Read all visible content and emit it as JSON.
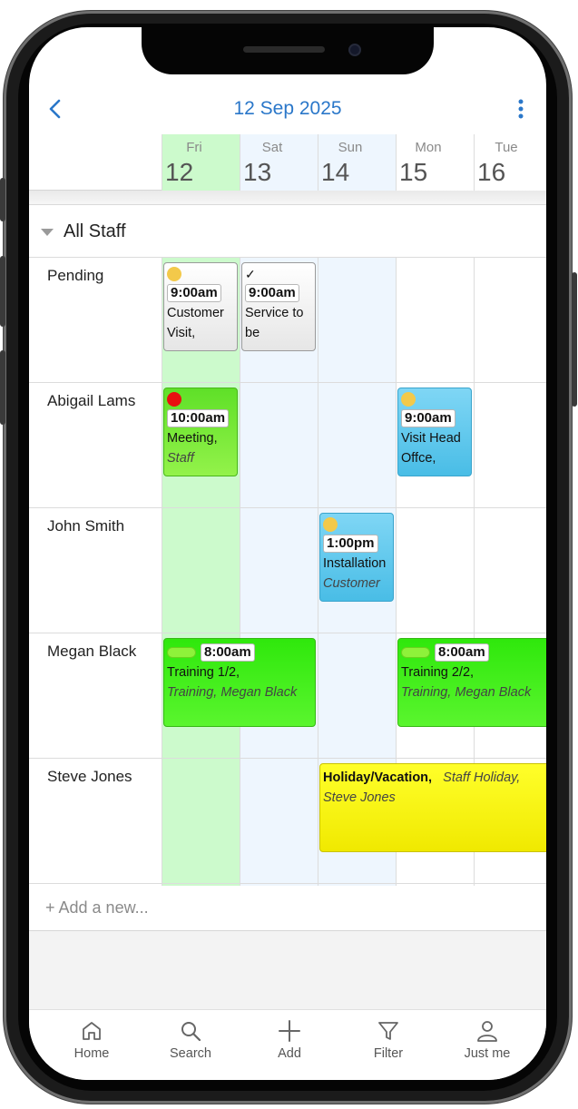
{
  "header": {
    "title": "12 Sep 2025"
  },
  "days": [
    {
      "dow": "Fri",
      "num": "12",
      "bg": "#ccfacc"
    },
    {
      "dow": "Sat",
      "num": "13",
      "bg": "#eef6fe"
    },
    {
      "dow": "Sun",
      "num": "14",
      "bg": "#eef6fe"
    },
    {
      "dow": "Mon",
      "num": "15",
      "bg": "#ffffff"
    },
    {
      "dow": "Tue",
      "num": "16",
      "bg": "#ffffff"
    }
  ],
  "group": {
    "label": "All Staff"
  },
  "rows": [
    {
      "label": "Pending"
    },
    {
      "label": "Abigail Lams"
    },
    {
      "label": "John Smith"
    },
    {
      "label": "Megan Black"
    },
    {
      "label": "Steve Jones"
    }
  ],
  "events": {
    "e1": {
      "time": "9:00am",
      "line1": "Customer",
      "line2": "Visit,",
      "status": "yellow-dot"
    },
    "e2": {
      "time": "9:00am",
      "line1": "Service to",
      "line2": "be",
      "status": "check"
    },
    "e3": {
      "time": "10:00am",
      "line1": "Meeting,",
      "sub": "Staff",
      "status": "red-dot"
    },
    "e4": {
      "time": "9:00am",
      "line1": "Visit Head",
      "line2": "Offce,",
      "status": "yellow-dot"
    },
    "e5": {
      "time": "1:00pm",
      "line1": "Installation",
      "sub": "Customer",
      "status": "yellow-dot"
    },
    "e6": {
      "time": "8:00am",
      "line1": "Training 1/2,",
      "sub": "Training, Megan Black"
    },
    "e7": {
      "time": "8:00am",
      "line1": "Training 2/2,",
      "sub": "Training, Megan Black"
    },
    "e8": {
      "title": "Holiday/Vacation,",
      "sub1": "Staff Holiday,",
      "sub2": "Steve Jones"
    }
  },
  "add_new": {
    "label": "+ Add a new..."
  },
  "tabs": [
    {
      "label": "Home",
      "icon": "home-icon"
    },
    {
      "label": "Search",
      "icon": "search-icon"
    },
    {
      "label": "Add",
      "icon": "plus-icon"
    },
    {
      "label": "Filter",
      "icon": "filter-icon"
    },
    {
      "label": "Just me",
      "icon": "person-icon"
    }
  ],
  "colors": {
    "accent": "#2a77c9",
    "today": "#ccfacc",
    "weekend": "#eef6fe"
  }
}
